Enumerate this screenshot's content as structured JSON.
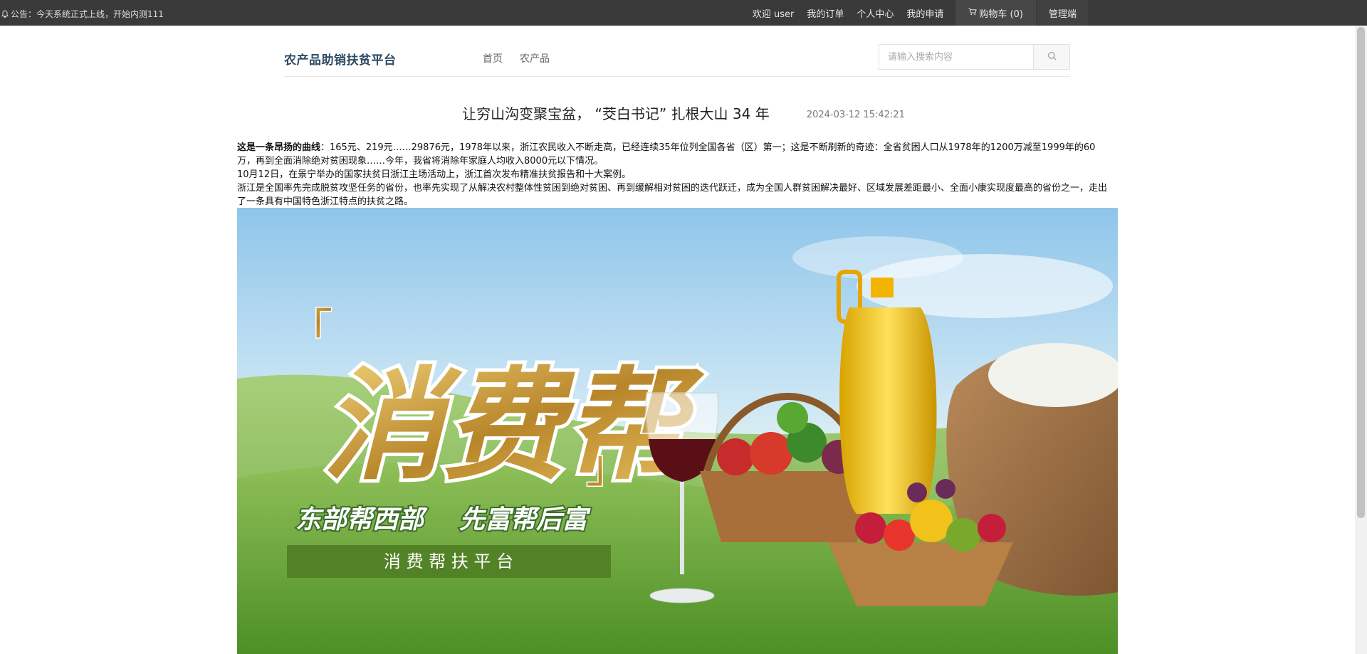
{
  "topbar": {
    "notice": "公告：今天系统正式上线，开始内测111",
    "welcome": "欢迎 user",
    "my_orders": "我的订单",
    "personal_center": "个人中心",
    "my_applications": "我的申请",
    "cart": "购物车 (0)",
    "admin": "管理端"
  },
  "header": {
    "logo": "农产品助销扶贫平台",
    "nav": [
      "首页",
      "农产品"
    ],
    "search_placeholder": "请输入搜索内容"
  },
  "article": {
    "title": "让穷山沟变聚宝盆， “茭白书记” 扎根大山 34 年",
    "date": "2024-03-12 15:42:21",
    "lead_bold": "这是一条昂扬的曲线",
    "lead_rest": "：165元、219元……29876元，1978年以来，浙江农民收入不断走高，已经连续35年位列全国各省（区）第一；这是不断刷新的奇迹：全省贫困人口从1978年的1200万减至1999年的60万，再到全面消除绝对贫困现象……今年，我省将消除年家庭人均收入8000元以下情况。",
    "para2": "10月12日，在景宁举办的国家扶贫日浙江主场活动上，浙江首次发布精准扶贫报告和十大案例。",
    "para3": "浙江是全国率先完成脱贫攻坚任务的省份，也率先实现了从解决农村整体性贫困到绝对贫困、再到缓解相对贫困的迭代跃迁，成为全国人群贫困解决最好、区域发展差距最小、全面小康实现度最高的省份之一，走出了一条具有中国特色浙江特点的扶贫之路。"
  },
  "banner": {
    "big_text": "消费帮",
    "slogan_left": "东部帮西部",
    "slogan_right": "先富帮后富",
    "subtitle": "消 费 帮 扶 平 台"
  },
  "colors": {
    "topbar_bg": "#3a3a3a",
    "logo": "#2c4a63",
    "banner_sky": "#a8d4ee",
    "banner_grass": "#6aa63a",
    "gold": "#c9962f"
  },
  "icons": {
    "notice": "bell-icon",
    "cart": "cart-icon",
    "search": "search-icon"
  }
}
